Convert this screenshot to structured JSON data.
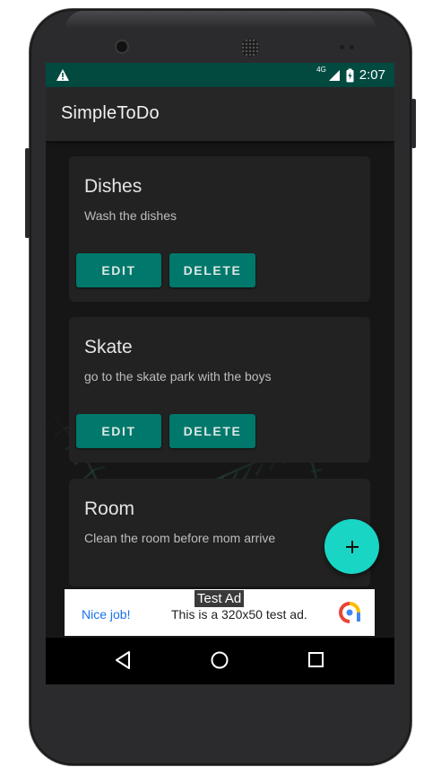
{
  "status_bar": {
    "time": "2:07",
    "network": "4G",
    "icons": [
      "warning-icon",
      "signal-icon",
      "battery-icon"
    ]
  },
  "app_bar": {
    "title": "SimpleToDo"
  },
  "tasks": [
    {
      "title": "Dishes",
      "description": "Wash the dishes",
      "edit_label": "EDIT",
      "delete_label": "DELETE"
    },
    {
      "title": "Skate",
      "description": "go to the skate park with the boys",
      "edit_label": "EDIT",
      "delete_label": "DELETE"
    },
    {
      "title": "Room",
      "description": "Clean the room before mom arrive"
    }
  ],
  "fab": {
    "icon": "plus-icon"
  },
  "ad": {
    "tag": "Test Ad",
    "nice": "Nice job!",
    "text": "This is a 320x50 test ad.",
    "icon": "admob-logo-icon"
  },
  "nav_bar": {
    "icons": [
      "back-icon",
      "home-icon",
      "recents-icon"
    ]
  },
  "colors": {
    "status_bar": "#024a40",
    "app_bar": "#262626",
    "card": "#222222",
    "button": "#00786b",
    "fab": "#19d5c4",
    "ad_link": "#1a73e8"
  }
}
